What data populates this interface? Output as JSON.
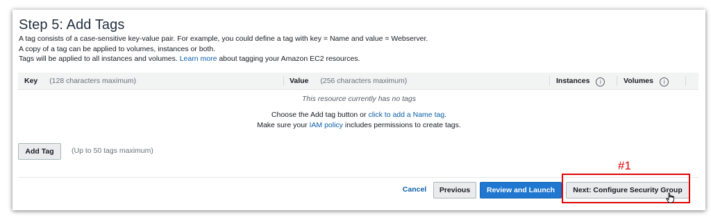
{
  "step": {
    "title": "Step 5: Add Tags",
    "line1": "A tag consists of a case-sensitive key-value pair. For example, you could define a tag with key = Name and value = Webserver.",
    "line2": "A copy of a tag can be applied to volumes, instances or both.",
    "line3_prefix": "Tags will be applied to all instances and volumes.",
    "line3_link": "Learn more",
    "line3_suffix": "about tagging your Amazon EC2 resources."
  },
  "table": {
    "key_label": "Key",
    "key_hint": "(128 characters maximum)",
    "value_label": "Value",
    "value_hint": "(256 characters maximum)",
    "instances_label": "Instances",
    "volumes_label": "Volumes",
    "info_glyph": "i",
    "empty": "This resource currently has no tags",
    "choose_prefix": "Choose the Add tag button or",
    "choose_link": "click to add a Name tag",
    "choose_suffix": ".",
    "iam_prefix": "Make sure your",
    "iam_link": "IAM policy",
    "iam_suffix": "includes permissions to create tags."
  },
  "actions": {
    "add_tag": "Add Tag",
    "add_tag_hint": "(Up to 50 tags maximum)",
    "cancel": "Cancel",
    "previous": "Previous",
    "review_launch": "Review and Launch",
    "next": "Next: Configure Security Group"
  },
  "annotation": {
    "marker": "#1",
    "color": "#e00000"
  },
  "colors": {
    "primary": "#1f77d0",
    "link": "#0a5ea8"
  }
}
